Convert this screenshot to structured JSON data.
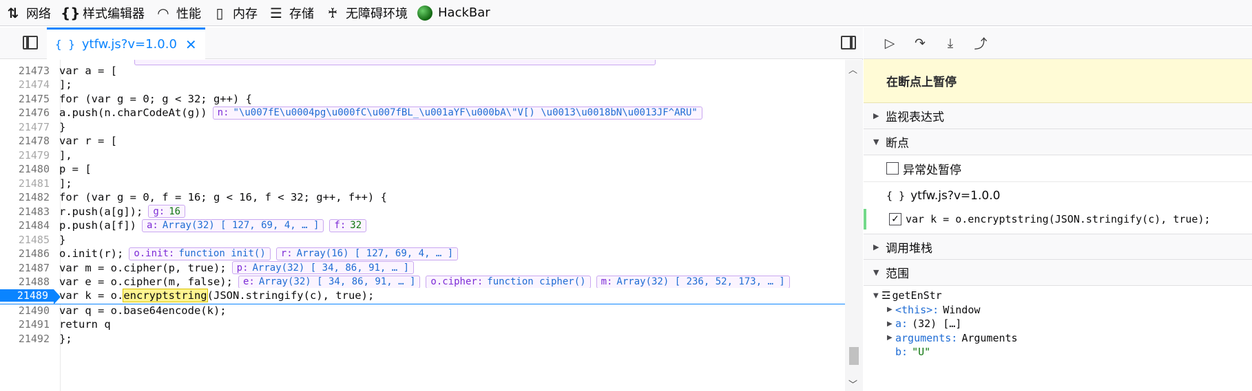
{
  "toolbar": {
    "tabs": [
      {
        "icon": "network-icon",
        "glyph": "⇅",
        "label": "网络"
      },
      {
        "icon": "style-editor-icon",
        "glyph": "{}",
        "label": "样式编辑器"
      },
      {
        "icon": "performance-icon",
        "glyph": "◠",
        "label": "性能"
      },
      {
        "icon": "memory-icon",
        "glyph": "▯",
        "label": "内存"
      },
      {
        "icon": "storage-icon",
        "glyph": "☰",
        "label": "存储"
      },
      {
        "icon": "accessibility-icon",
        "glyph": "♰",
        "label": "无障碍环境"
      },
      {
        "icon": "hackbar-icon",
        "glyph": "",
        "label": "HackBar"
      }
    ]
  },
  "editor": {
    "file_tab": {
      "brace": "{ }",
      "name": "ytfw.js?v=1.0.0",
      "close": "✕"
    },
    "lines": [
      {
        "no": "21473",
        "code": "var a = ["
      },
      {
        "no": "21474",
        "code": "];"
      },
      {
        "no": "21475",
        "code": "for (var g = 0; g < 32; g++) {"
      },
      {
        "no": "21476",
        "code": "a.push(n.charCodeAt(g))"
      },
      {
        "no": "21477",
        "code": "}"
      },
      {
        "no": "21478",
        "code": "var r = ["
      },
      {
        "no": "21479",
        "code": "],"
      },
      {
        "no": "21480",
        "code": "p = ["
      },
      {
        "no": "21481",
        "code": "];"
      },
      {
        "no": "21482",
        "code": "for (var g = 0, f = 16; g < 16, f < 32; g++, f++) {"
      },
      {
        "no": "21483",
        "code": "r.push(a[g]);"
      },
      {
        "no": "21484",
        "code": "p.push(a[f])"
      },
      {
        "no": "21485",
        "code": "}"
      },
      {
        "no": "21486",
        "code": "o.init(r);"
      },
      {
        "no": "21487",
        "code": "var m = o.cipher(p, true);"
      },
      {
        "no": "21488",
        "code": "var e = o.cipher(m, false);"
      },
      {
        "no": "21489",
        "code_a": "var k = o.",
        "code_hl": "encryptstring",
        "code_b": "(JSON.stringify(c), true);"
      },
      {
        "no": "21490",
        "code": "var q = o.base64encode(k);"
      },
      {
        "no": "21491",
        "code": "return q"
      },
      {
        "no": "21492",
        "code": "};"
      }
    ],
    "previews": {
      "l21476": [
        {
          "k": "n:",
          "v": "\"\\u007fE\\u0004pg\\u000fC\\u007fBL_\\u001aYF\\u000bA\\\"V[) \\u0013\\u0018bN\\u0013JF^ARU\""
        }
      ],
      "l21483": [
        {
          "k": "g:",
          "v": "16"
        }
      ],
      "l21484": [
        {
          "k": "a:",
          "v": "Array(32) [ 127, 69, 4, … ]"
        },
        {
          "k": "f:",
          "v": "32"
        }
      ],
      "l21486": [
        {
          "k": "o.init:",
          "v": "function init()"
        },
        {
          "k": "r:",
          "v": "Array(16) [ 127, 69, 4, … ]"
        }
      ],
      "l21487": [
        {
          "k": "p:",
          "v": "Array(32) [ 34, 86, 91, … ]"
        }
      ],
      "l21488": [
        {
          "k": "e:",
          "v": "Array(32) [ 34, 86, 91, … ]"
        },
        {
          "k": "o.cipher:",
          "v": "function cipher()"
        },
        {
          "k": "m:",
          "v": "Array(32) [ 236, 52, 173, … ]"
        }
      ]
    }
  },
  "debugger": {
    "paused_message": "在断点上暂停",
    "sections": {
      "watch": "监视表达式",
      "breakpoints": "断点",
      "call_stack": "调用堆栈",
      "scopes": "范围"
    },
    "pause_on_exceptions": "异常处暂停",
    "bp_file": {
      "brace": "{ }",
      "name": "ytfw.js?v=1.0.0"
    },
    "bp_code": "var k = o.encryptstring(JSON.stringify(c), true);",
    "scope": {
      "block": "getEnStr",
      "rows": [
        {
          "key": "<this>:",
          "val": "Window"
        },
        {
          "key": "a:",
          "val": "(32) […]"
        },
        {
          "key": "arguments:",
          "val": "Arguments"
        },
        {
          "key": "b:",
          "val": "\"U\""
        }
      ]
    }
  }
}
